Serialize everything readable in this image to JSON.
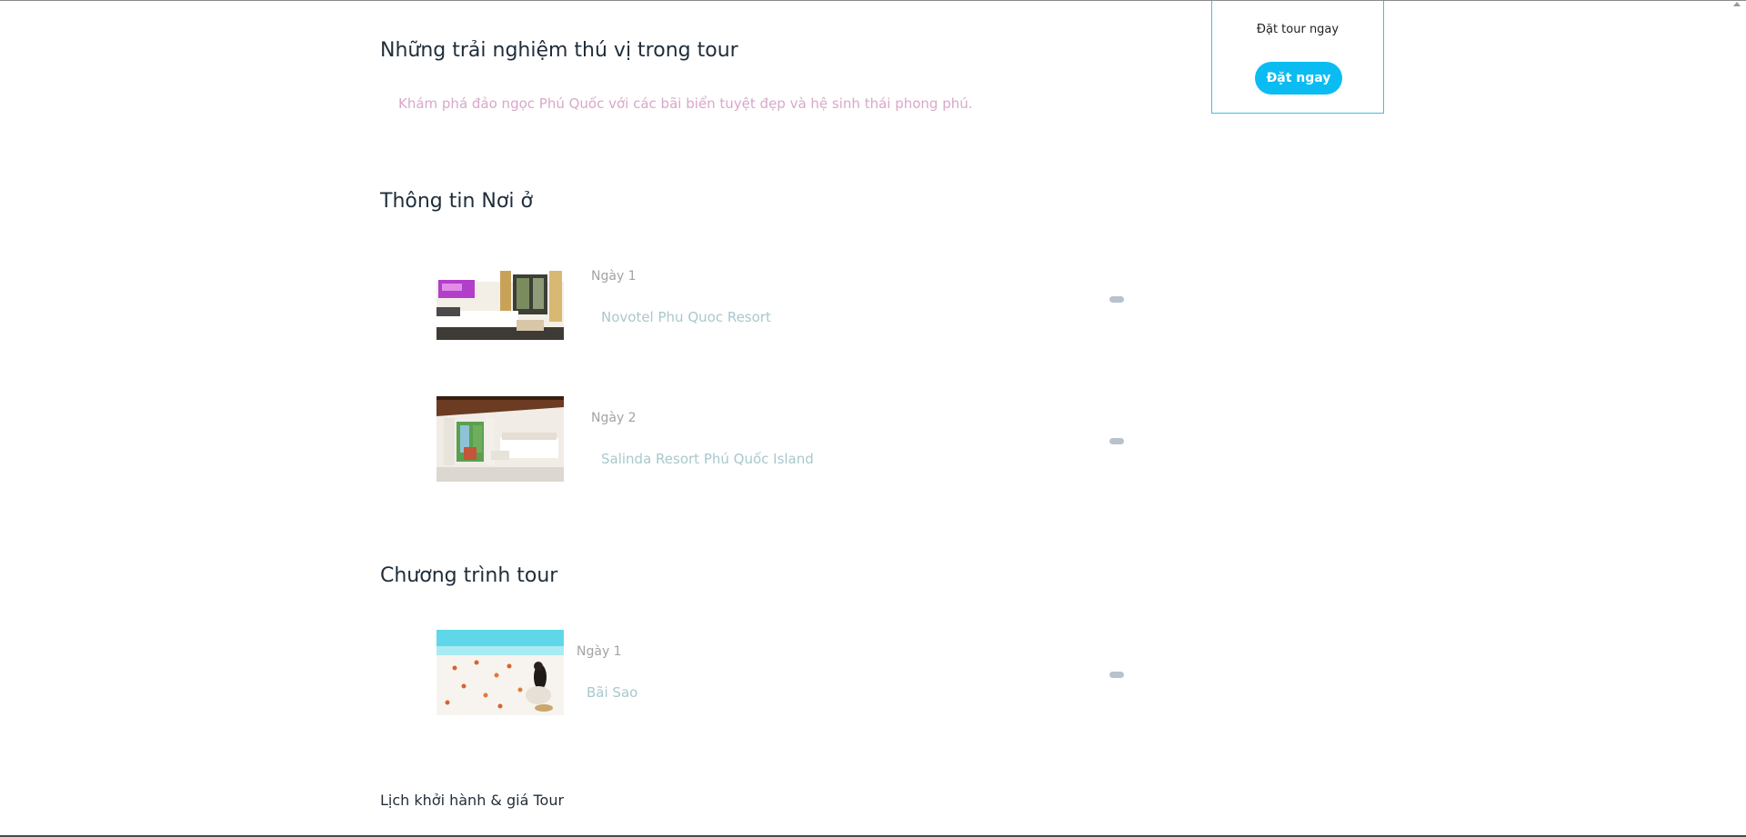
{
  "experience": {
    "heading": "Những trải nghiệm thú vị trong tour",
    "description": "Khám phá đảo ngọc Phú Quốc với các bãi biển tuyệt đẹp và hệ sinh thái phong phú."
  },
  "accommodation": {
    "heading": "Thông tin Nơi ở",
    "items": [
      {
        "day": "Ngày 1",
        "name": "Novotel Phu Quoc Resort"
      },
      {
        "day": "Ngày 2",
        "name": "Salinda Resort Phú Quốc Island"
      }
    ]
  },
  "program": {
    "heading": "Chương trình tour",
    "items": [
      {
        "day": "Ngày 1",
        "name": "Bãi Sao"
      }
    ]
  },
  "schedule": {
    "heading": "Lịch khởi hành & giá Tour"
  },
  "booking": {
    "title": "Đặt tour ngay",
    "button_label": "Đặt ngay"
  },
  "colors": {
    "accent": "#0bbcf2",
    "box_border": "#3cc2e0",
    "intro_text": "#d9a8c8",
    "place_text": "#a9c8cc"
  }
}
